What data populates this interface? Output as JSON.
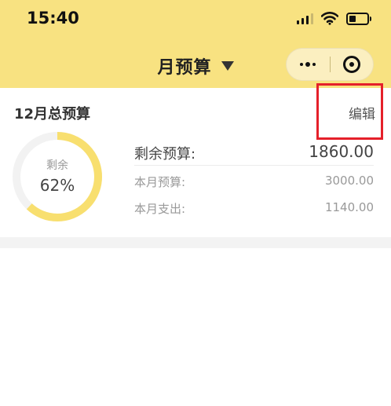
{
  "status_bar": {
    "time": "15:40",
    "signal_icon": "signal-icon",
    "wifi_icon": "wifi-icon",
    "battery_icon": "battery-icon",
    "battery_level": 0.4
  },
  "nav": {
    "title": "月预算",
    "dropdown_icon": "caret-down-icon",
    "more_icon": "more-dots-icon",
    "close_icon": "target-close-icon"
  },
  "budget_card": {
    "title": "12月总预算",
    "edit_label": "编辑",
    "ring": {
      "label": "剩余",
      "percent_text": "62%",
      "remaining_fraction": 0.62
    },
    "remaining_label": "剩余预算:",
    "remaining_value": "1860.00",
    "monthly_budget_label": "本月预算:",
    "monthly_budget_value": "3000.00",
    "monthly_expense_label": "本月支出:",
    "monthly_expense_value": "1140.00"
  },
  "colors": {
    "header_bg": "#F8E281",
    "ring_fill": "#F8DF6F",
    "ring_track": "#F2F2F2",
    "highlight_box": "#E5202A"
  }
}
